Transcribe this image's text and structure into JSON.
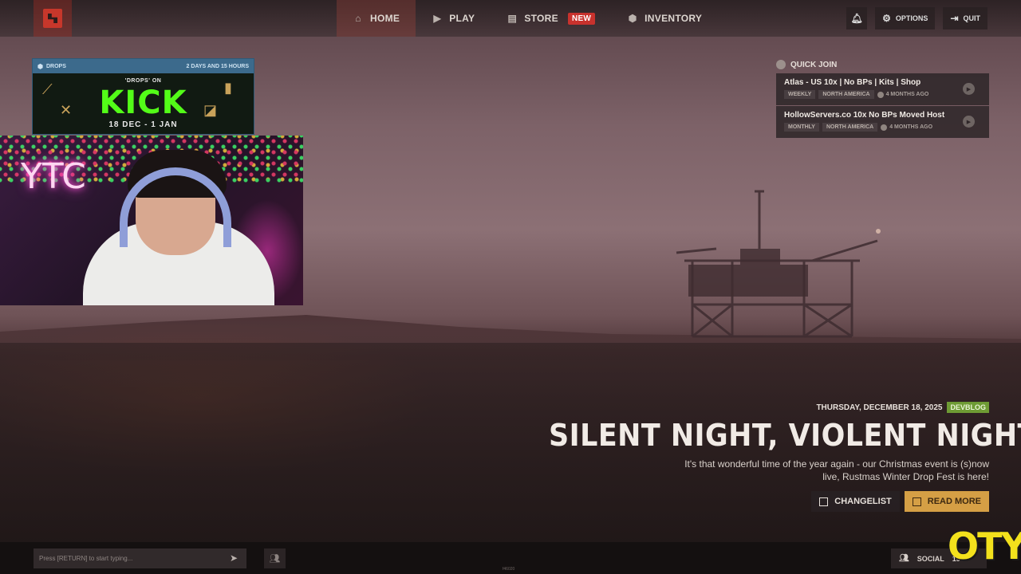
{
  "nav": {
    "items": [
      {
        "label": "HOME",
        "icon": "home-icon",
        "active": true
      },
      {
        "label": "PLAY",
        "icon": "play-icon",
        "active": false
      },
      {
        "label": "STORE",
        "icon": "store-icon",
        "active": false,
        "badge": "NEW"
      },
      {
        "label": "INVENTORY",
        "icon": "cube-icon",
        "active": false
      }
    ],
    "options_label": "OPTIONS",
    "quit_label": "QUIT"
  },
  "drops": {
    "header_label": "DROPS",
    "time_left": "2 DAYS AND 15 HOURS",
    "banner_top": "'DROPS' ON",
    "banner_brand": "KICK",
    "banner_dates": "18 DEC - 1 JAN"
  },
  "webcam": {
    "neon_text": "YTC"
  },
  "quick_join": {
    "title": "QUICK JOIN",
    "servers": [
      {
        "name": "Atlas - US 10x | No BPs | Kits | Shop",
        "schedule": "WEEKLY",
        "region": "NORTH AMERICA",
        "updated": "4 MONTHS AGO"
      },
      {
        "name": "HollowServers.co 10x No BPs Moved Host",
        "schedule": "MONTHLY",
        "region": "NORTH AMERICA",
        "updated": "4 MONTHS AGO"
      }
    ]
  },
  "devblog": {
    "date": "THURSDAY, DECEMBER 18, 2025",
    "badge": "DEVBLOG",
    "title": "SILENT NIGHT, VIOLENT NIGHT",
    "description": "It's that wonderful time of the year again - our Christmas event is (s)now live, Rustmas Winter Drop Fest is here!",
    "changelog_label": "CHANGELIST",
    "read_more_label": "READ MORE"
  },
  "bottom": {
    "chat_placeholder": "Press [RETURN] to start typing...",
    "version_text": "f46020",
    "social_label": "SOCIAL",
    "social_count": "19"
  },
  "overlay": {
    "watermark": "OTY"
  },
  "colors": {
    "accent_red": "#c8322d",
    "read_more": "#d59f45",
    "devblog_green": "#6e9b34",
    "kick_green": "#53fc18"
  }
}
